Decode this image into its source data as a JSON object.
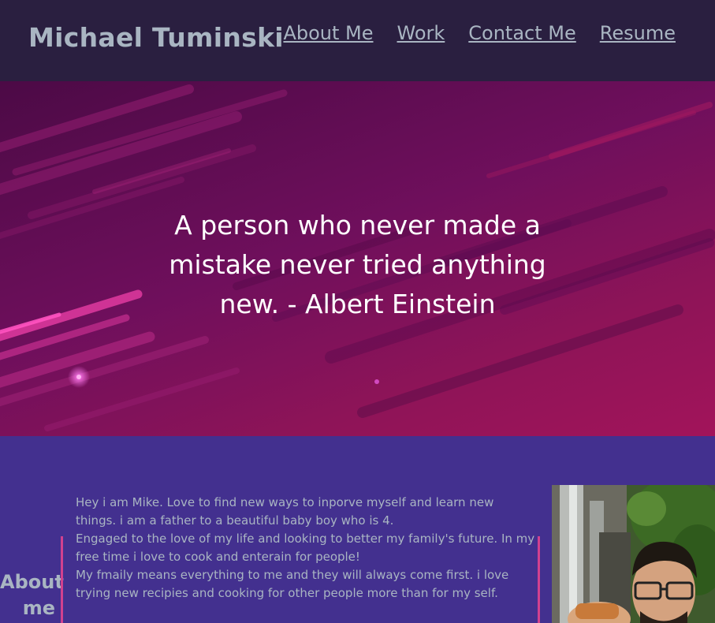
{
  "header": {
    "site_name": "Michael Tuminski",
    "nav": [
      "About Me",
      "Work",
      "Contact Me",
      "Resume"
    ]
  },
  "hero": {
    "quote": "A person who never made a mistake never tried anything new. - Albert Einstein"
  },
  "about": {
    "title": "About me",
    "paragraph": "Hey i am Mike. Love to find new ways to inporve myself and learn new things. i am a father to a beautiful baby boy who is 4.\nEngaged to the love of my life and looking to better my family's future. In my free time i love to cook and enterain for people!\nMy fmaily means everything to me and they will always come first. i love trying new recipies and cooking for other people more than for my self."
  },
  "colors": {
    "header_bg": "#2a1f40",
    "page_bg": "#43308f",
    "text": "#a9b5c2",
    "accent": "#d1418f"
  }
}
